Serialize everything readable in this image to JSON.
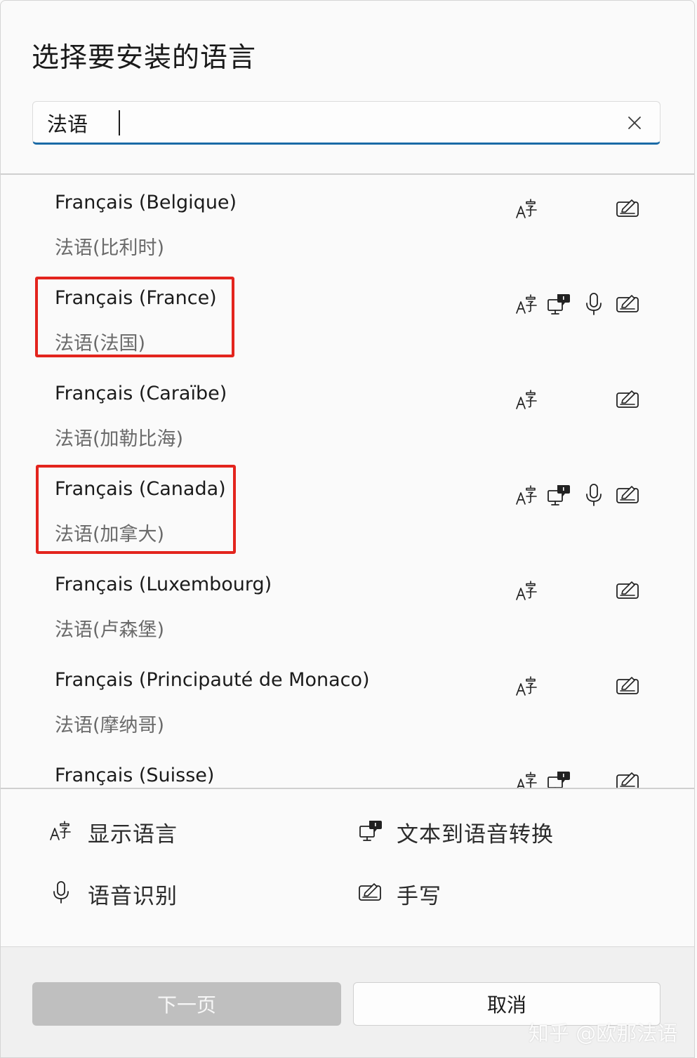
{
  "dialog": {
    "title": "选择要安装的语言",
    "search": {
      "value": "法语"
    }
  },
  "languages": [
    {
      "name": "Français (Belgique)",
      "sub": "法语(比利时)",
      "features": [
        "display",
        "handwriting"
      ]
    },
    {
      "name": "Français (France)",
      "sub": "法语(法国)",
      "features": [
        "display",
        "tts",
        "speech",
        "handwriting"
      ]
    },
    {
      "name": "Français (Caraïbe)",
      "sub": "法语(加勒比海)",
      "features": [
        "display",
        "handwriting"
      ]
    },
    {
      "name": "Français (Canada)",
      "sub": "法语(加拿大)",
      "features": [
        "display",
        "tts",
        "speech",
        "handwriting"
      ]
    },
    {
      "name": "Français (Luxembourg)",
      "sub": "法语(卢森堡)",
      "features": [
        "display",
        "handwriting"
      ]
    },
    {
      "name": "Français (Principauté de Monaco)",
      "sub": "法语(摩纳哥)",
      "features": [
        "display",
        "handwriting"
      ]
    },
    {
      "name": "Français (Suisse)",
      "sub": "",
      "features": [
        "display",
        "tts",
        "handwriting"
      ]
    }
  ],
  "legend": {
    "display": "显示语言",
    "tts": "文本到语音转换",
    "speech": "语音识别",
    "handwriting": "手写"
  },
  "buttons": {
    "next": "下一页",
    "cancel": "取消"
  },
  "watermark": "知乎 @欧那法语",
  "icons": {
    "display": "display-language-icon",
    "tts": "text-to-speech-icon",
    "speech": "microphone-icon",
    "handwriting": "handwriting-icon",
    "clear": "close-icon"
  },
  "colors": {
    "highlight": "#e3241d",
    "accent": "#1a6aa6",
    "next_disabled": "#bfbfbf"
  }
}
